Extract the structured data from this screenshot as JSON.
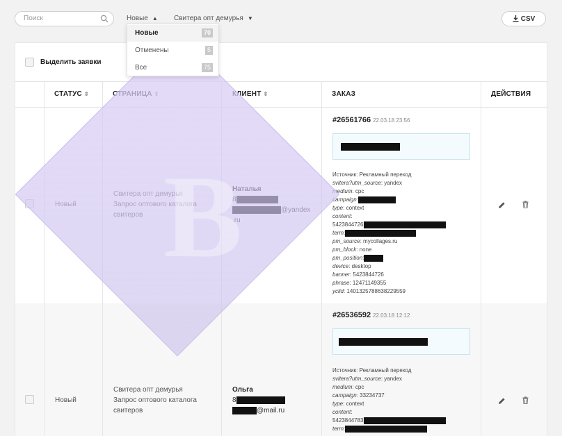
{
  "toolbar": {
    "search_placeholder": "Поиск",
    "filter_status": "Новые",
    "filter_status_caret": "▲",
    "filter_page": "Свитера опт демурья",
    "filter_page_caret": "▼",
    "csv_label": "CSV"
  },
  "dropdown": {
    "items": [
      {
        "label": "Новые",
        "count": "70",
        "active": true
      },
      {
        "label": "Отменены",
        "count": "5",
        "active": false
      },
      {
        "label": "Все",
        "count": "75",
        "active": false
      }
    ]
  },
  "table": {
    "select_all_label": "Выделить заявки",
    "headers": {
      "status": "СТАТУС",
      "page": "СТРАНИЦА",
      "client": "КЛИЕНТ",
      "order": "ЗАКАЗ",
      "actions": "ДЕЙСТВИЯ"
    },
    "sort_glyph": "⇕",
    "rows": [
      {
        "status": "Новый",
        "page_line1": "Свитера опт демурья",
        "page_line2": "Запрос оптового каталога",
        "page_line3": "свитеров",
        "client_name": "Наталья",
        "client_phone_prefix": "8",
        "client_email_suffix": "@yandex",
        "client_email_tld": ".ru",
        "order_no": "#26561766",
        "order_date": "22.03.18 23:56",
        "meta": [
          {
            "k": "Источник",
            "v": ": Рекламный переход"
          },
          {
            "k": "svitera?utm_source",
            "v": ": yandex"
          },
          {
            "k": "medium",
            "v": ": cpc"
          },
          {
            "k": "campaign",
            "v": ":"
          },
          {
            "k": "type",
            "v": ": context"
          },
          {
            "k": "content",
            "v": ":"
          },
          {
            "k": "",
            "v": "5423844726"
          },
          {
            "k": "term",
            "v": ":"
          },
          {
            "k": "pm_source",
            "v": ": mycollages.ru"
          },
          {
            "k": "pm_block",
            "v": ": none"
          },
          {
            "k": "pm_position",
            "v": ":"
          },
          {
            "k": "device",
            "v": ": desktop"
          },
          {
            "k": "banner",
            "v": ": 5423844726"
          },
          {
            "k": "phrase",
            "v": ": 12471149355"
          },
          {
            "k": "yclid",
            "v": ": 1401325788638229559"
          }
        ]
      },
      {
        "status": "Новый",
        "page_line1": "Свитера опт демурья",
        "page_line2": "Запрос оптового каталога",
        "page_line3": "свитеров",
        "client_name": "Ольга",
        "client_phone_prefix": "8",
        "client_email_suffix": "@mail.ru",
        "order_no": "#26536592",
        "order_date": "22.03.18 12:12",
        "meta": [
          {
            "k": "Источник",
            "v": ": Рекламный переход"
          },
          {
            "k": "svitera?utm_source",
            "v": ": yandex"
          },
          {
            "k": "medium",
            "v": ": cpc"
          },
          {
            "k": "campaign",
            "v": ": 33234737"
          },
          {
            "k": "type",
            "v": ": context"
          },
          {
            "k": "content",
            "v": ":"
          },
          {
            "k": "",
            "v": "5423844783"
          },
          {
            "k": "term",
            "v": ":"
          }
        ]
      }
    ]
  },
  "icons": [
    "search-icon",
    "download-icon",
    "edit-icon",
    "trash-icon",
    "sort-icon"
  ]
}
